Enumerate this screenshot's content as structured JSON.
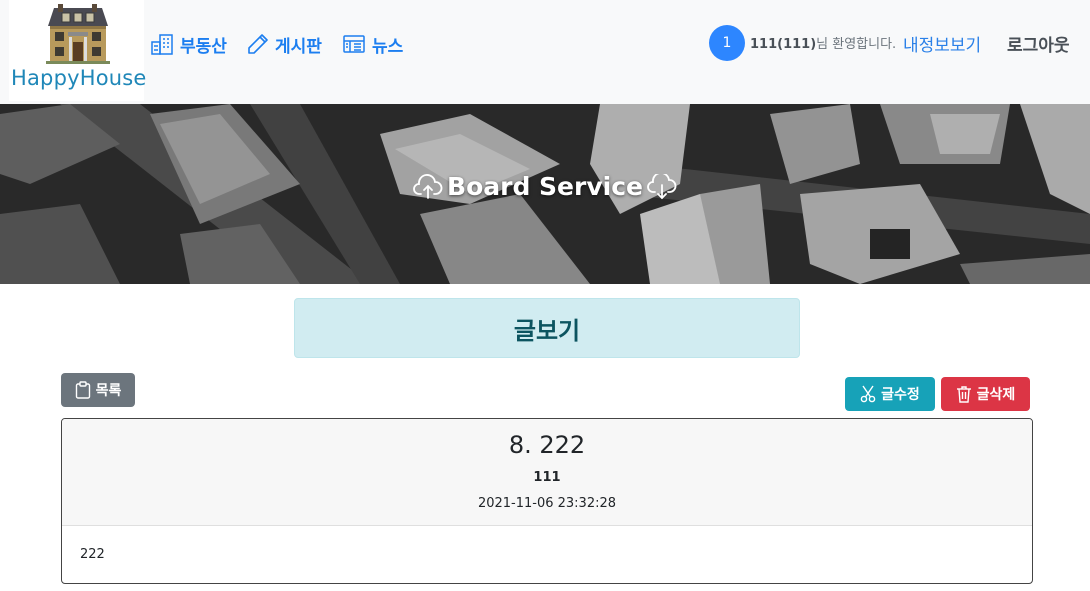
{
  "brand": {
    "name": "HappyHouse"
  },
  "nav": {
    "items": [
      {
        "label": "부동산",
        "icon": "buildings-icon"
      },
      {
        "label": "게시판",
        "icon": "pencil-icon"
      },
      {
        "label": "뉴스",
        "icon": "newspaper-icon"
      }
    ]
  },
  "user": {
    "badge": "1",
    "name": "111(111)",
    "welcome_suffix": "님 환영합니다.",
    "mypage_label": "내정보보기",
    "logout_label": "로그아웃"
  },
  "banner": {
    "title": "Board Service"
  },
  "page": {
    "heading": "글보기"
  },
  "toolbar": {
    "list_label": "목록",
    "edit_label": "글수정",
    "delete_label": "글삭제"
  },
  "post": {
    "title": "8. 222",
    "author": "111",
    "date": "2021-11-06 23:32:28",
    "content": "222"
  },
  "colors": {
    "primary": "#1c7ef0",
    "secondary": "#6c757d",
    "info": "#17a2b8",
    "danger": "#dc3545",
    "alert_bg": "#d1ecf1",
    "alert_text": "#0c5460"
  }
}
